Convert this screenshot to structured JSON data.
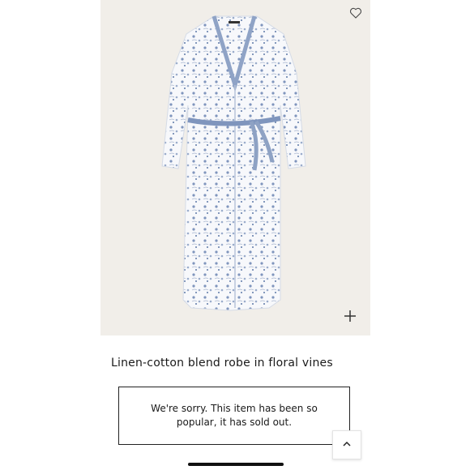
{
  "product": {
    "title": "Linen-cotton blend robe in floral vines",
    "image_alt": "Floral vines linen-cotton robe",
    "background_color": "#f1eee9",
    "print_color": "#6f86b0"
  },
  "actions": {
    "wishlist_icon": "heart-icon",
    "zoom_icon": "plus-icon",
    "scroll_top_icon": "chevron-up-icon"
  },
  "notice": {
    "message": "We're sorry. This item has been so popular, it has sold out."
  }
}
